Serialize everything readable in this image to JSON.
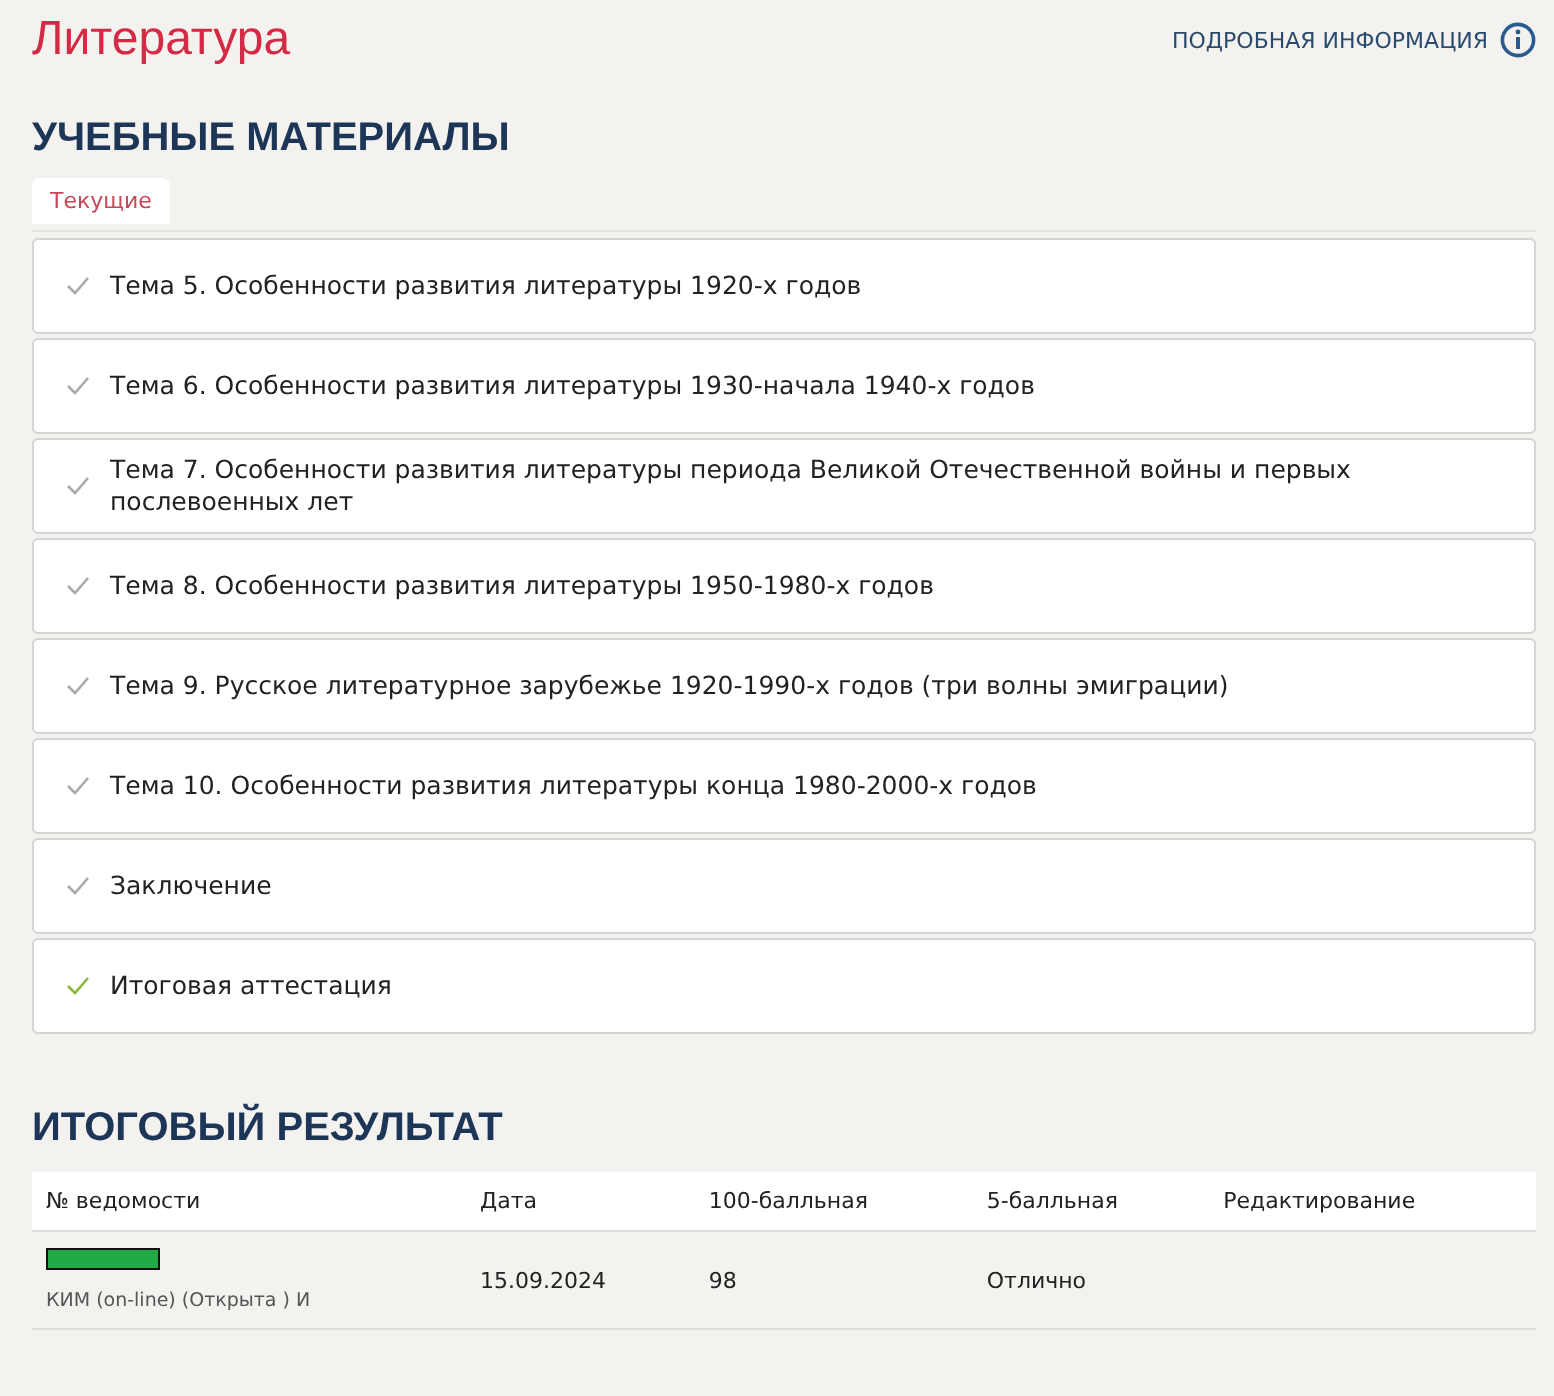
{
  "page_title": "Литература",
  "info_link": "ПОДРОБНАЯ ИНФОРМАЦИЯ",
  "materials": {
    "heading": "УЧЕБНЫЕ МАТЕРИАЛЫ",
    "tabs": [
      {
        "label": "Текущие",
        "selected": true
      }
    ],
    "topics": [
      {
        "title": "Тема 5. Особенности развития литературы 1920-х годов",
        "completed": false
      },
      {
        "title": "Тема 6. Особенности развития литературы 1930-начала 1940-х годов",
        "completed": false
      },
      {
        "title": "Тема 7. Особенности развития литературы периода Великой Отечественной войны и первых послевоенных лет",
        "completed": false
      },
      {
        "title": "Тема 8. Особенности развития литературы 1950-1980-х годов",
        "completed": false
      },
      {
        "title": "Тема 9. Русское литературное зарубежье 1920-1990-х годов (три волны эмиграции)",
        "completed": false
      },
      {
        "title": "Тема 10. Особенности развития литературы конца 1980-2000-х годов",
        "completed": false
      },
      {
        "title": "Заключение",
        "completed": false
      },
      {
        "title": "Итоговая аттестация",
        "completed": true
      }
    ]
  },
  "result": {
    "heading": "ИТОГОВЫЙ РЕЗУЛЬТАТ",
    "columns": [
      "№ ведомости",
      "Дата",
      "100-балльная",
      "5-балльная",
      "Редактирование"
    ],
    "rows": [
      {
        "color": "#22aa44",
        "statement": "КИМ (on-line) (Открыта ) И",
        "date": "15.09.2024",
        "score_100": "98",
        "score_5": "Отлично"
      }
    ]
  }
}
